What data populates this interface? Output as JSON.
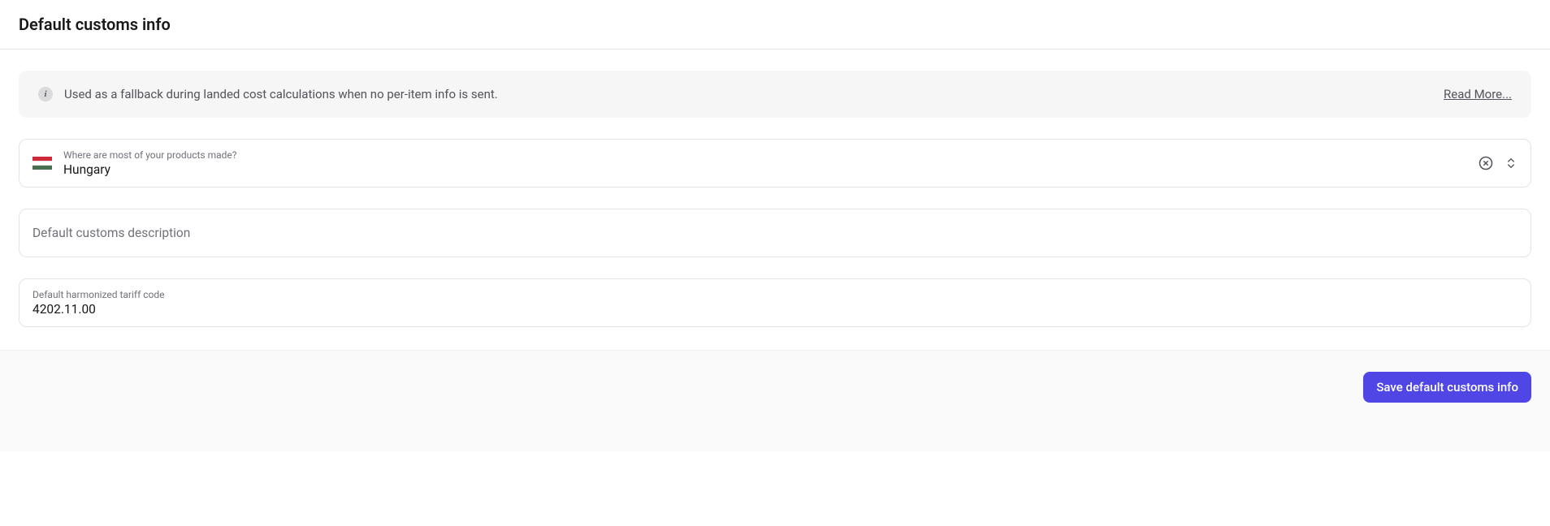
{
  "header": {
    "title": "Default customs info"
  },
  "banner": {
    "text": "Used as a fallback during landed cost calculations when no per-item info is sent.",
    "link": "Read More..."
  },
  "country_field": {
    "label": "Where are most of your products made?",
    "value": "Hungary"
  },
  "description_field": {
    "placeholder": "Default customs description",
    "value": ""
  },
  "tariff_field": {
    "label": "Default harmonized tariff code",
    "value": "4202.11.00"
  },
  "footer": {
    "save_label": "Save default customs info"
  }
}
